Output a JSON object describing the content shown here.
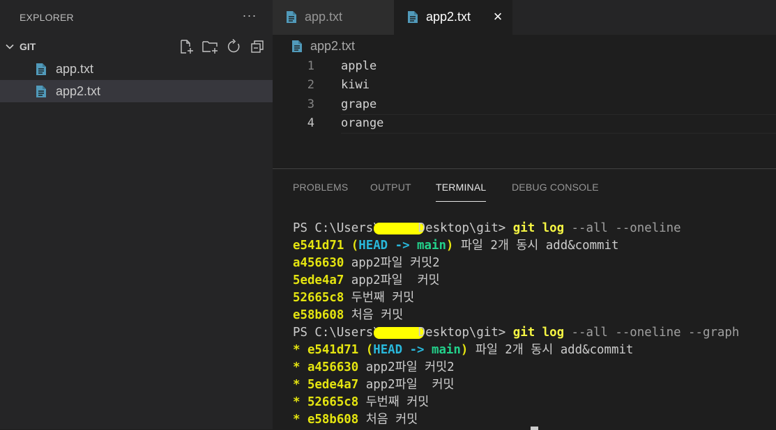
{
  "explorer": {
    "title": "EXPLORER",
    "more": "···",
    "section": {
      "title": "GIT",
      "actions": [
        "new-file-icon",
        "new-folder-icon",
        "refresh-icon",
        "collapse-all-icon"
      ]
    },
    "files": [
      {
        "name": "app.txt",
        "selected": false
      },
      {
        "name": "app2.txt",
        "selected": true
      }
    ]
  },
  "tabs": [
    {
      "label": "app.txt",
      "active": false
    },
    {
      "label": "app2.txt",
      "active": true,
      "close": "×"
    }
  ],
  "breadcrumb": {
    "file": "app2.txt"
  },
  "editor": {
    "lines": [
      {
        "num": "1",
        "text": "apple"
      },
      {
        "num": "2",
        "text": "kiwi"
      },
      {
        "num": "3",
        "text": "grape"
      },
      {
        "num": "4",
        "text": "orange",
        "current": true
      }
    ]
  },
  "panel": {
    "tabs": [
      "PROBLEMS",
      "OUTPUT",
      "TERMINAL",
      "DEBUG CONSOLE"
    ],
    "active_tab": "TERMINAL"
  },
  "terminal": {
    "prompt1": {
      "pre": "PS C:\\Users\\",
      "post": "Desktop\\git> ",
      "cmd": "git log ",
      "args": "--all --oneline"
    },
    "log1": [
      {
        "hash": "e541d71",
        "head": "HEAD -> ",
        "branch": "main",
        "msg": " 파일 2개 동시 add&commit"
      },
      {
        "hash": "a456630",
        "msg": " app2파일 커밋2"
      },
      {
        "hash": "5ede4a7",
        "msg": " app2파일  커밋"
      },
      {
        "hash": "52665c8",
        "msg": " 두번째 커밋"
      },
      {
        "hash": "e58b608",
        "msg": " 처음 커밋"
      }
    ],
    "prompt2": {
      "pre": "PS C:\\Users\\",
      "post": "Desktop\\git> ",
      "cmd": "git log ",
      "args": "--all --oneline --graph"
    },
    "log2": [
      {
        "star": "* ",
        "hash": "e541d71",
        "head": "HEAD -> ",
        "branch": "main",
        "msg": " 파일 2개 동시 add&commit"
      },
      {
        "star": "* ",
        "hash": "a456630",
        "msg": " app2파일 커밋2"
      },
      {
        "star": "* ",
        "hash": "5ede4a7",
        "msg": " app2파일  커밋"
      },
      {
        "star": "* ",
        "hash": "52665c8",
        "msg": " 두번째 커밋"
      },
      {
        "star": "* ",
        "hash": "e58b608",
        "msg": " 처음 커밋"
      }
    ]
  },
  "colors": {
    "hash": "#e5e510",
    "head": "#29b8db",
    "branch": "#23d18b",
    "file_icon": "#519aba",
    "redaction": "#ffff00"
  }
}
